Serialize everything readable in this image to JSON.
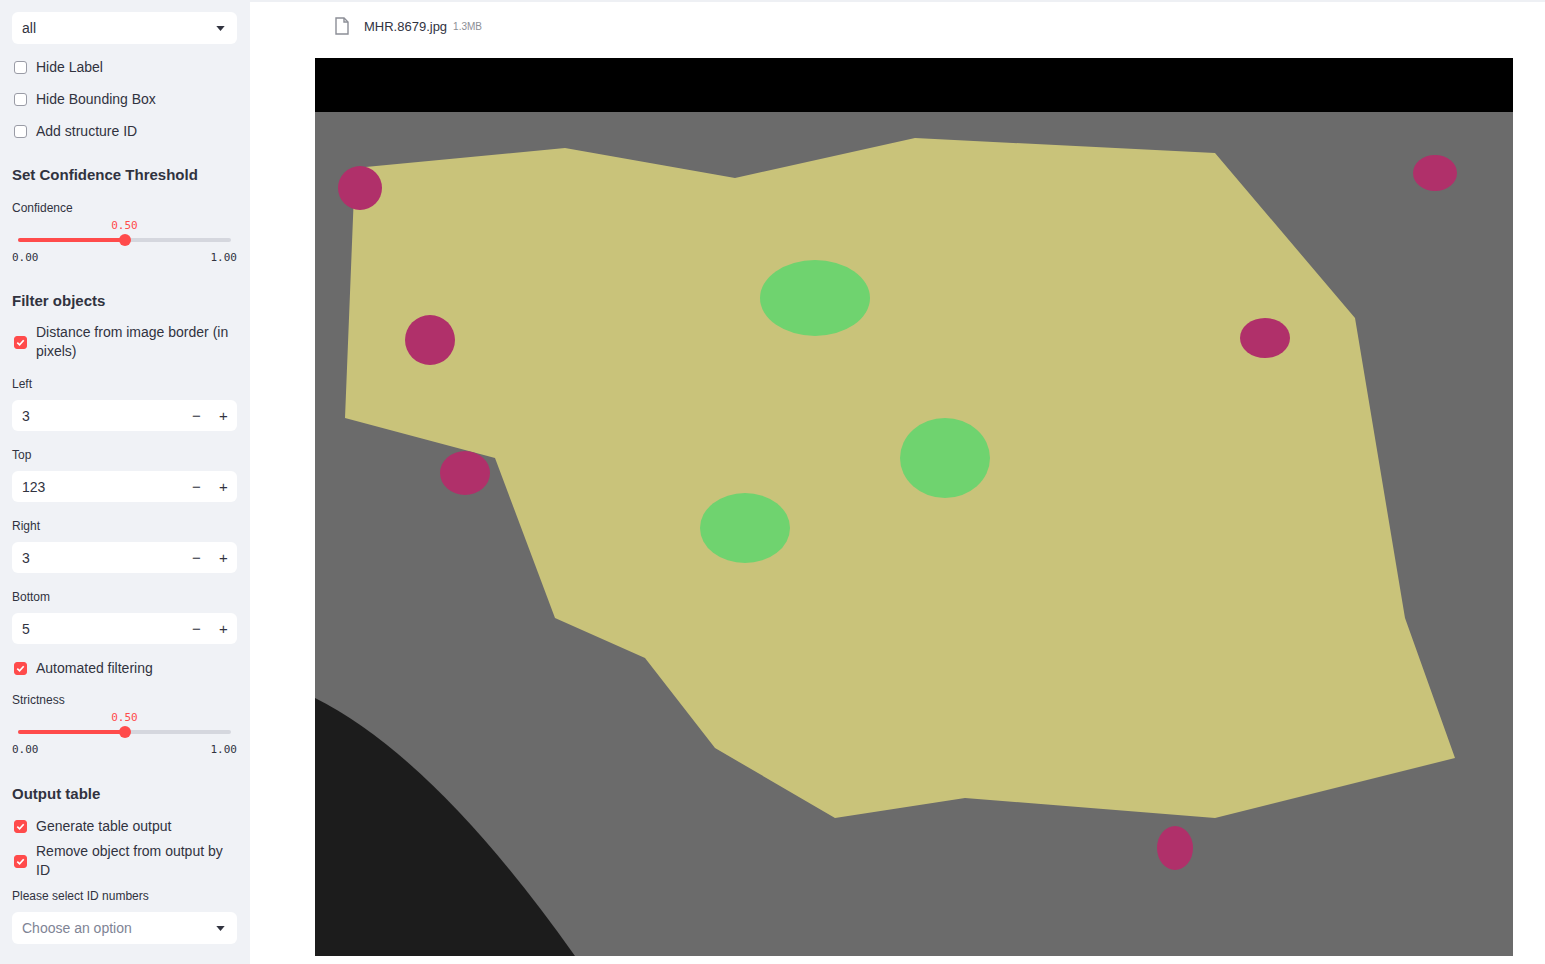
{
  "sidebar": {
    "controls": [
      {
        "kind": "select",
        "value": "all"
      },
      {
        "kind": "checkbox",
        "label": "Hide Label",
        "checked": false
      },
      {
        "kind": "checkbox",
        "label": "Hide Bounding Box",
        "checked": false
      },
      {
        "kind": "checkbox",
        "label": "Add structure ID",
        "checked": false
      },
      {
        "kind": "heading",
        "label": "Set Confidence Threshold"
      },
      {
        "kind": "slider",
        "label": "Confidence",
        "value": "0.50",
        "min": "0.00",
        "max": "1.00",
        "level": 0.5
      },
      {
        "kind": "heading",
        "label": "Filter objects"
      },
      {
        "kind": "checkbox",
        "label": "Distance from image border (in pixels)",
        "checked": true
      },
      {
        "kind": "number",
        "label": "Left",
        "value": "3",
        "decrement": "−",
        "increment": "+"
      },
      {
        "kind": "number",
        "label": "Top",
        "value": "123",
        "decrement": "−",
        "increment": "+"
      },
      {
        "kind": "number",
        "label": "Right",
        "value": "3",
        "decrement": "−",
        "increment": "+"
      },
      {
        "kind": "number",
        "label": "Bottom",
        "value": "5",
        "decrement": "−",
        "increment": "+"
      },
      {
        "kind": "checkbox",
        "label": "Automated filtering",
        "checked": true
      },
      {
        "kind": "slider",
        "label": "Strictness",
        "value": "0.50",
        "min": "0.00",
        "max": "1.00",
        "level": 0.5
      },
      {
        "kind": "heading",
        "label": "Output table"
      },
      {
        "kind": "checkbox",
        "label": "Generate table output",
        "checked": true
      },
      {
        "kind": "checkbox",
        "label": "Remove object from output by ID",
        "checked": true
      },
      {
        "kind": "multiselect",
        "label": "Please select ID numbers",
        "placeholder": "Choose an option"
      }
    ]
  },
  "file": {
    "name": "MHR.8679.jpg",
    "size": "1.3MB"
  }
}
